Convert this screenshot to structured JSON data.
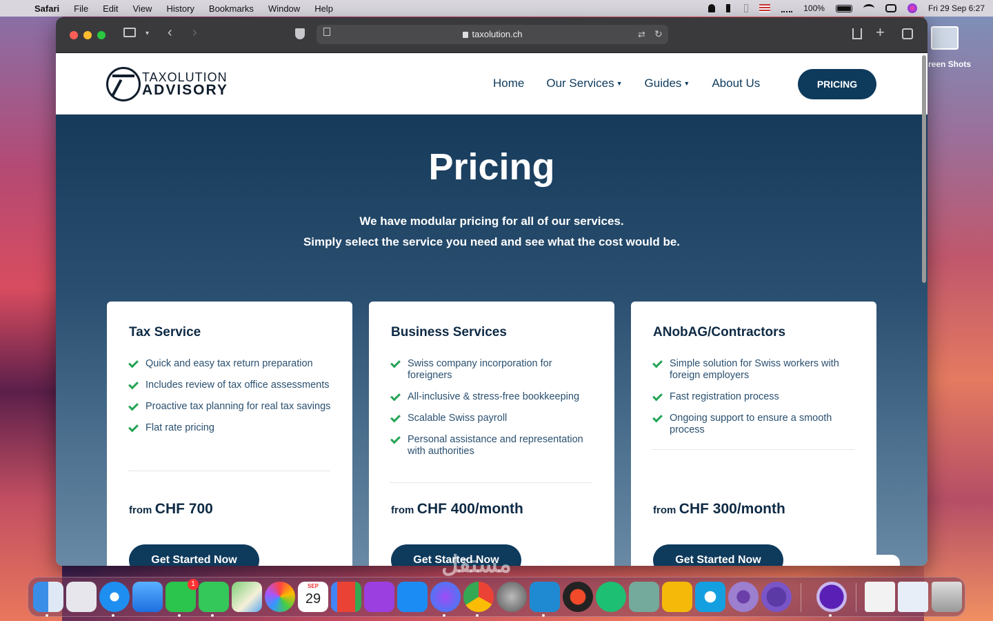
{
  "menubar": {
    "app": "Safari",
    "items": [
      "File",
      "Edit",
      "View",
      "History",
      "Bookmarks",
      "Window",
      "Help"
    ],
    "battery": "100%",
    "datetime": "Fri 29 Sep  6:27"
  },
  "desktop": {
    "icon_label": "reen Shots"
  },
  "browser": {
    "url": "taxolution.ch"
  },
  "site": {
    "logo_line1": "TAXOLUTION",
    "logo_line2": "ADVISORY",
    "nav": [
      "Home",
      "Our Services",
      "Guides",
      "About Us"
    ],
    "pricing_button": "PRICING"
  },
  "hero": {
    "title": "Pricing",
    "subtitle_1": "We have modular pricing for all of our services.",
    "subtitle_2": "Simply select the service you need and see what the cost would be."
  },
  "cards": [
    {
      "title": "Tax Service",
      "features": [
        "Quick and easy tax return preparation",
        "Includes review of tax office assessments",
        "Proactive tax planning for real tax savings",
        "Flat rate pricing"
      ],
      "from": "from",
      "price": "CHF 700",
      "cta": "Get Started Now"
    },
    {
      "title": "Business Services",
      "features": [
        "Swiss company incorporation for foreigners",
        "All-inclusive & stress-free bookkeeping",
        "Scalable Swiss payroll",
        "Personal assistance and representation with authorities"
      ],
      "from": "from",
      "price": "CHF 400/month",
      "cta": "Get Started Now"
    },
    {
      "title": "ANobAG/Contractors",
      "features": [
        "Simple solution for Swiss workers with foreign employers",
        "Fast registration process",
        "Ongoing support to ensure a smooth process"
      ],
      "from": "from",
      "price": "CHF 300/month",
      "cta": "Get Started Now"
    }
  ],
  "dock": {
    "calendar_month": "SEP",
    "calendar_day": "29",
    "facetime_badge": "1",
    "apps": [
      "finder-icon",
      "launchpad-icon",
      "safari-icon",
      "mail-icon",
      "facetime-icon",
      "messages-icon",
      "maps-icon",
      "photos-icon",
      "calendar-icon",
      "gmail-icon",
      "podcasts-icon",
      "app-store-icon",
      "messenger-icon",
      "chrome-icon",
      "system-settings-icon",
      "vscode-icon",
      "recorder-icon",
      "fiverr-icon",
      "chatgpt-icon",
      "five-icon",
      "signal-icon",
      "radar-icon",
      "proton-icon",
      "disk-utility-icon",
      "window-preview-icon",
      "window-preview-2-icon",
      "trash-icon"
    ]
  },
  "watermark": "مستقل"
}
